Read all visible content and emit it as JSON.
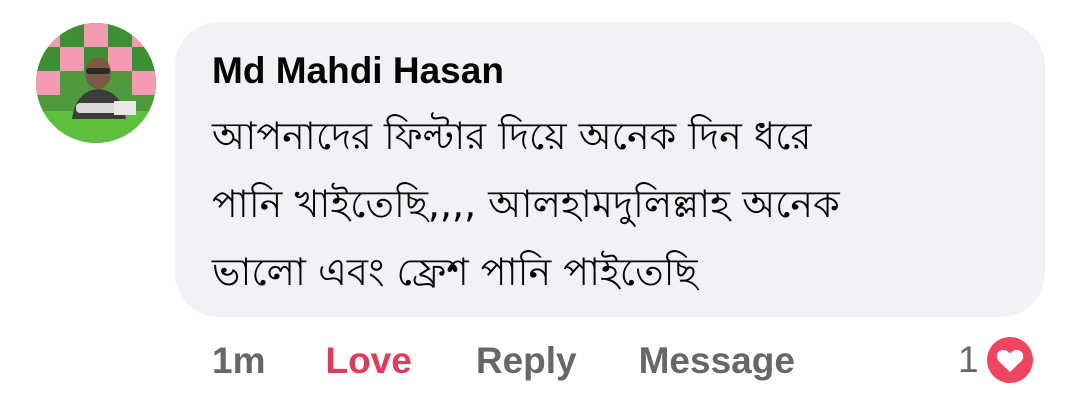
{
  "comment": {
    "author": "Md Mahdi Hasan",
    "text_lines": [
      "আপনাদের ফিল্টার দিয়ে অনেক দিন ধরে",
      "পানি খাইতেছি,,,, আলহামদুলিল্লাহ অনেক",
      "ভালো এবং ফ্রেশ পানি পাইতেছি"
    ],
    "avatar_icon": "profile-photo"
  },
  "actions": {
    "time": "1m",
    "love_label": "Love",
    "reply_label": "Reply",
    "message_label": "Message"
  },
  "reactions": {
    "count": "1",
    "icon": "love-reaction-icon"
  },
  "colors": {
    "bubble_bg": "#f0f2f5",
    "love_accent": "#e5395a",
    "secondary_text": "#65676b"
  }
}
